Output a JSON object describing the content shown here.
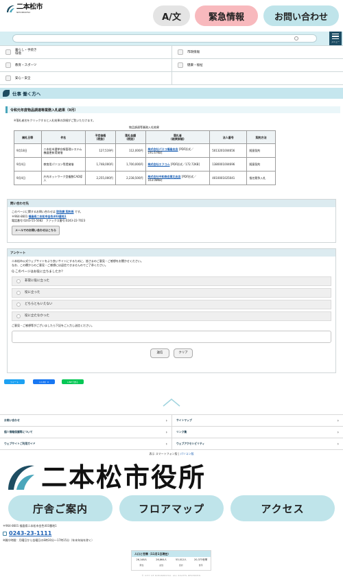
{
  "header": {
    "logo_text": "二本松市",
    "logo_sub": "NIHONMATSU",
    "lang_label": "A/文",
    "emergency_label": "緊急情報",
    "contact_label": "お問い合わせ"
  },
  "menu": {
    "label": "メニュー"
  },
  "categories": [
    [
      "暮らし・手続き\n環境",
      "市政情報"
    ],
    [
      "教育・スポーツ",
      "健康・福祉"
    ],
    [
      "安心・安全",
      ""
    ]
  ],
  "section": {
    "title": "仕事 働く方へ"
  },
  "page": {
    "heading": "令和元年度物品調達等業務入札結果（9月）",
    "note": "※落札者名をクリックすると入札結果の詳細がご覧いただけます。",
    "table_caption": "物品調達等業務入札結果"
  },
  "bid_table": {
    "headers": [
      "開札日等",
      "件名",
      "予定価格\n(税抜)",
      "落札金額\n(税抜)",
      "落札者\n(結果詳細)",
      "法人番号",
      "契約方法"
    ],
    "rows": [
      {
        "date": "9月18日",
        "subject": "二本松市選挙台帳管理システム機器更新賃貸借",
        "planned": "127,519円",
        "bid": "112,000円",
        "winner": "株式会社パスコ福島支店",
        "detail": "[PDF形式／191.67KB]",
        "corp": "5013201004656",
        "method": "随意契約"
      },
      {
        "date": "9月4日",
        "subject": "教育用パソコン等賃貸借",
        "planned": "1,748,000円",
        "bid": "1,700,000円",
        "winner": "株式会社エフコム",
        "detail": "[PDF形式／172.72KB]",
        "corp": "1380001004696",
        "method": "随意契約"
      },
      {
        "date": "9月4日",
        "subject": "庁内ネットワーク型複数CAD導入",
        "planned": "2,255,000円",
        "bid": "2,238,500円",
        "winner": "株式会社中和商会東北支店",
        "detail": "[PDF形式／163.08KB]",
        "corp": "4010001025041",
        "method": "指名競争入札"
      }
    ]
  },
  "inquiry": {
    "title": "問い合わせ先",
    "line1_pre": "このページに関するお問い合わせは ",
    "dept": "財政課 契約係",
    "line1_post": " です。",
    "addr_pre": "〒964-8601 ",
    "addr": "福島県二本松市金色403番地1",
    "phone": "電話番号:0243-55-5082　ファックス番号:0243-22-7023",
    "mail_btn": "メールでのお問い合わせはこちら"
  },
  "survey": {
    "title": "アンケート",
    "intro1": "二本松市公式ウェブサイトをより良いサイトにするために、皆さまのご意見・ご感想をお聞かせください。",
    "intro2": "なお、この欄からのご意見・ご感想には返信できませんのでご了承ください。",
    "question": "Q.このページはお役に立ちましたか？",
    "options": [
      "非常に役に立った",
      "役に立った",
      "どちらともいえない",
      "役に立たなかった"
    ],
    "comment_label": "ご意見・ご感想等がございましたら下記をご入力し送信ください。",
    "submit": "送信",
    "clear": "クリア"
  },
  "social": {
    "tweet": "ツイート",
    "like": "いいね！0",
    "line": "LINEで送る"
  },
  "footer_links": [
    [
      "お問い合わせ",
      "サイトマップ"
    ],
    [
      "個人情報保護等について",
      "リンク集"
    ],
    [
      "ウェブサイトご利用ガイド",
      "ウェブアクセシビリティ"
    ]
  ],
  "display": {
    "label": "表示",
    "smartphone": "スマートフォン版",
    "pc": "パソコン版"
  },
  "footer": {
    "logo_text": "二本松市役所",
    "buttons": [
      "庁舎ご案内",
      "フロアマップ",
      "アクセス"
    ],
    "address": "〒964-8601 福島県二本松市金色403番地1",
    "tel": "0243-23-1111",
    "hours": "※開庁時間：月曜日から金曜日の8時30分〜17時15分（年末年始を除く）",
    "copyright": "© CITY OF NIHONMATSU. ALL RIGHTS RESERVED."
  },
  "population": {
    "title": "人口と世帯（11月1日現在）",
    "values": [
      "26,148人",
      "26,864人",
      "53,012人",
      "20,373世帯"
    ],
    "labels": [
      "男性",
      "女性",
      "合計",
      "世帯"
    ]
  },
  "colors": {
    "accent": "#1e4d62",
    "light_blue": "#bfe4ea",
    "emergency": "#f8b9bd"
  }
}
